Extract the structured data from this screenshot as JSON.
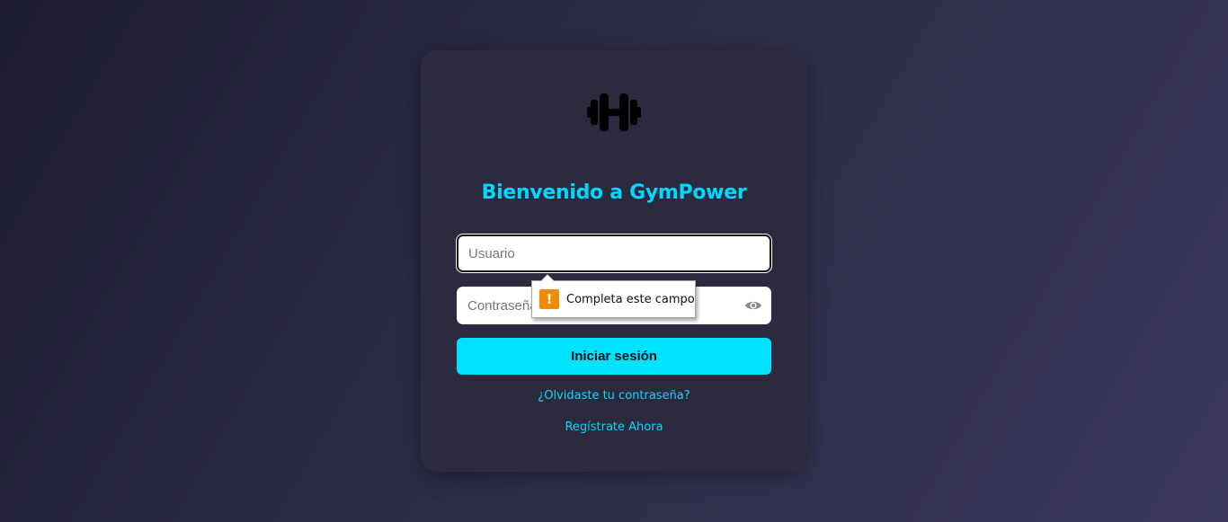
{
  "login": {
    "logo_icon": "dumbbell-icon",
    "title": "Bienvenido a GymPower",
    "username": {
      "value": "",
      "placeholder": "Usuario"
    },
    "password": {
      "value": "",
      "placeholder": "Contraseña",
      "toggle_icon": "eye-icon"
    },
    "validation_tooltip": {
      "icon": "warning-icon",
      "text": "Completa este campo"
    },
    "submit_label": "Iniciar sesión",
    "forgot_link": "¿Olvidaste tu contraseña?",
    "register_link": "Regístrate Ahora"
  },
  "colors": {
    "accent": "#00e1ff",
    "card_bg": "#2b2a3f",
    "warning": "#f08a00"
  }
}
